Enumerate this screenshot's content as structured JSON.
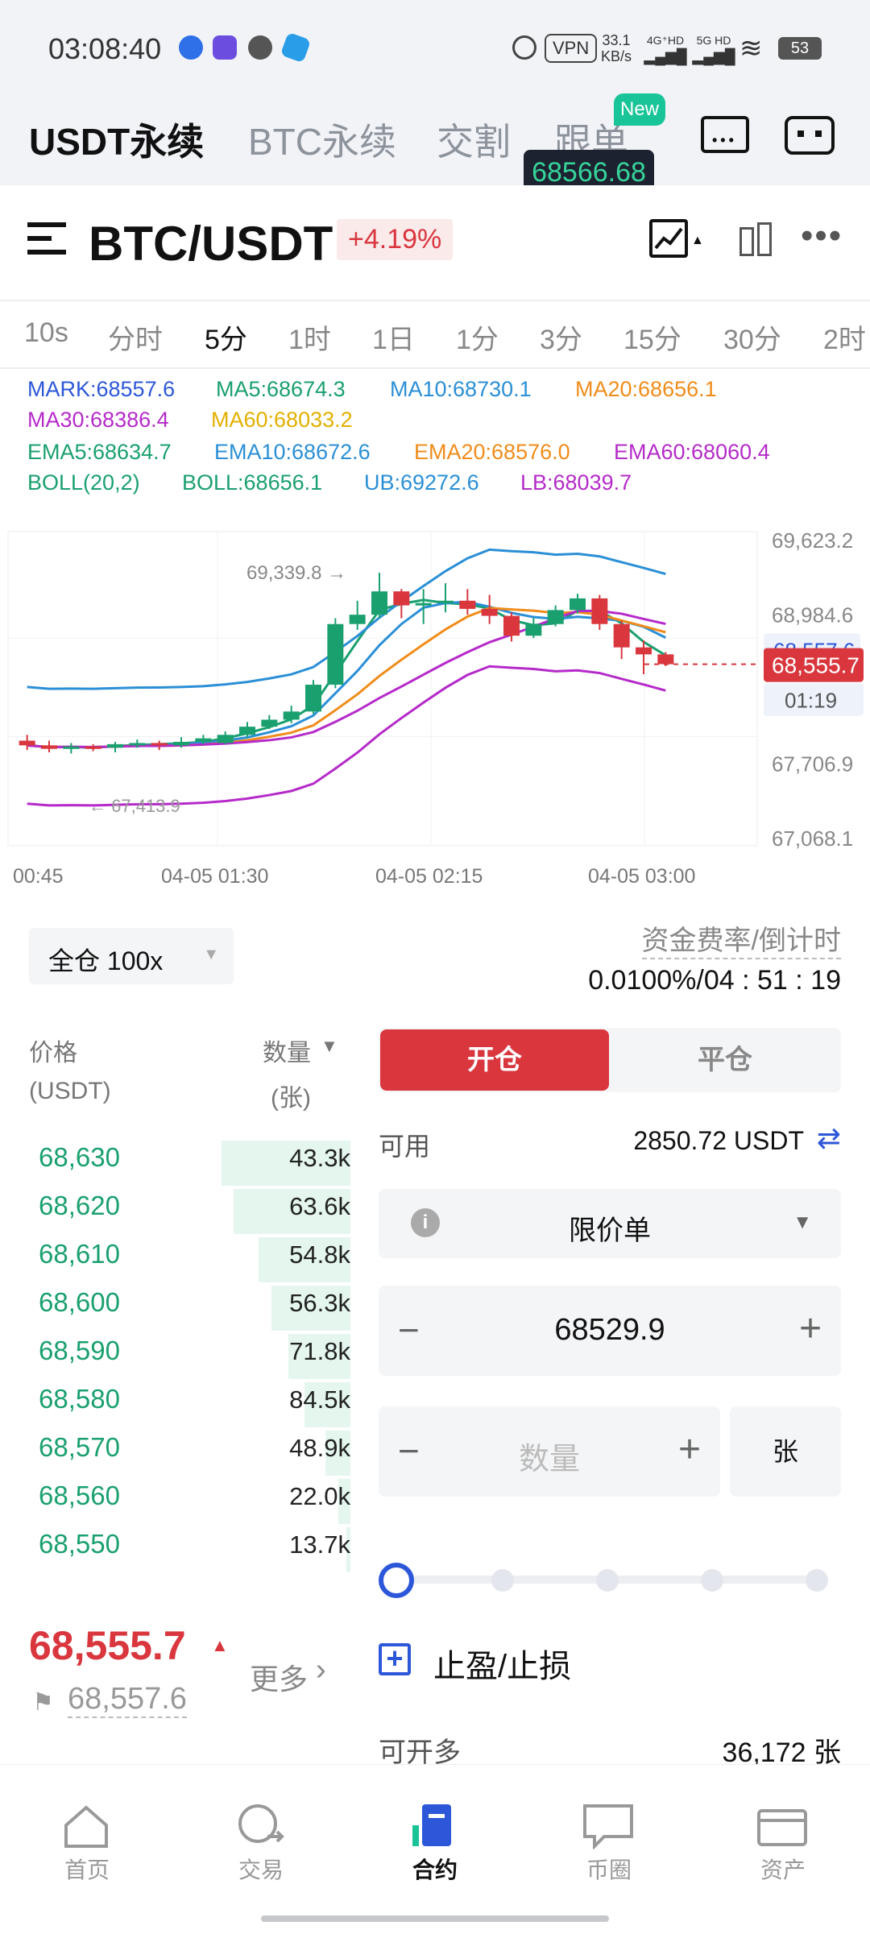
{
  "status_bar": {
    "time": "03:08:40",
    "vpn": "VPN",
    "net_speed": "33.1",
    "net_unit": "KB/s",
    "sig1": "4G⁺HD",
    "sig2": "5G HD",
    "battery": "53"
  },
  "top_tabs": [
    {
      "label": "USDT永续"
    },
    {
      "label": "BTC永续"
    },
    {
      "label": "交割"
    },
    {
      "label": "跟单"
    }
  ],
  "new_badge": "New",
  "floating_price": "68566.68",
  "header": {
    "pair": "BTC/USDT",
    "change": "+4.19%"
  },
  "intervals": [
    {
      "label": "10s"
    },
    {
      "label": "分时"
    },
    {
      "label": "5分"
    },
    {
      "label": "1时"
    },
    {
      "label": "1日"
    },
    {
      "label": "1分"
    },
    {
      "label": "3分"
    },
    {
      "label": "15分"
    },
    {
      "label": "30分"
    },
    {
      "label": "2时"
    }
  ],
  "indicators": {
    "mark": "MARK:68557.6",
    "ma5": "MA5:68674.3",
    "ma10": "MA10:68730.1",
    "ma20": "MA20:68656.1",
    "ma30": "MA30:68386.4",
    "ma60": "MA60:68033.2",
    "ema5": "EMA5:68634.7",
    "ema10": "EMA10:68672.6",
    "ema20": "EMA20:68576.0",
    "ema60": "EMA60:68060.4",
    "boll": "BOLL(20,2)",
    "boll_val": "BOLL:68656.1",
    "ub": "UB:69272.6",
    "lb": "LB:68039.7"
  },
  "chart_data": {
    "type": "candlestick",
    "y_ticks": [
      "69,623.2",
      "68,984.6",
      "67,706.9",
      "67,068.1"
    ],
    "x_ticks": [
      "00:45",
      "04-05 01:30",
      "04-05 02:15",
      "04-05 03:00"
    ],
    "high_label": "69,339.8 →",
    "low_label": "← 67,413.9",
    "mark_label": "68,557.6",
    "last_label": "68,555.7",
    "countdown": "01:19",
    "ylim": [
      67068.1,
      69623.2
    ],
    "candles": [
      {
        "o": 67900,
        "c": 67860,
        "h": 67950,
        "l": 67820
      },
      {
        "o": 67860,
        "c": 67830,
        "h": 67900,
        "l": 67800
      },
      {
        "o": 67830,
        "c": 67850,
        "h": 67880,
        "l": 67790
      },
      {
        "o": 67850,
        "c": 67840,
        "h": 67870,
        "l": 67810
      },
      {
        "o": 67840,
        "c": 67870,
        "h": 67890,
        "l": 67800
      },
      {
        "o": 67870,
        "c": 67880,
        "h": 67910,
        "l": 67840
      },
      {
        "o": 67880,
        "c": 67860,
        "h": 67900,
        "l": 67820
      },
      {
        "o": 67860,
        "c": 67890,
        "h": 67930,
        "l": 67840
      },
      {
        "o": 67890,
        "c": 67920,
        "h": 67950,
        "l": 67870
      },
      {
        "o": 67880,
        "c": 67950,
        "h": 67980,
        "l": 67870
      },
      {
        "o": 67950,
        "c": 68020,
        "h": 68060,
        "l": 67930
      },
      {
        "o": 68020,
        "c": 68080,
        "h": 68120,
        "l": 68000
      },
      {
        "o": 68080,
        "c": 68150,
        "h": 68200,
        "l": 68050
      },
      {
        "o": 68150,
        "c": 68380,
        "h": 68420,
        "l": 68130
      },
      {
        "o": 68380,
        "c": 68900,
        "h": 68950,
        "l": 68350
      },
      {
        "o": 68900,
        "c": 68980,
        "h": 69100,
        "l": 68850
      },
      {
        "o": 68980,
        "c": 69180,
        "h": 69340,
        "l": 68950
      },
      {
        "o": 69180,
        "c": 69060,
        "h": 69200,
        "l": 68950
      },
      {
        "o": 69060,
        "c": 69080,
        "h": 69200,
        "l": 68900
      },
      {
        "o": 69080,
        "c": 69100,
        "h": 69250,
        "l": 69000
      },
      {
        "o": 69100,
        "c": 69030,
        "h": 69200,
        "l": 68980
      },
      {
        "o": 69030,
        "c": 68970,
        "h": 69150,
        "l": 68900
      },
      {
        "o": 68970,
        "c": 68800,
        "h": 69000,
        "l": 68750
      },
      {
        "o": 68800,
        "c": 68900,
        "h": 68950,
        "l": 68780
      },
      {
        "o": 68900,
        "c": 69020,
        "h": 69060,
        "l": 68880
      },
      {
        "o": 69020,
        "c": 69120,
        "h": 69160,
        "l": 68990
      },
      {
        "o": 69120,
        "c": 68900,
        "h": 69150,
        "l": 68850
      },
      {
        "o": 68900,
        "c": 68700,
        "h": 68930,
        "l": 68600
      },
      {
        "o": 68700,
        "c": 68640,
        "h": 68760,
        "l": 68470
      },
      {
        "o": 68640,
        "c": 68556,
        "h": 68660,
        "l": 68540
      }
    ]
  },
  "margin_mode": "全仓 100x",
  "funding": {
    "label": "资金费率/倒计时",
    "value": "0.0100%/04 : 51 : 19"
  },
  "orderbook": {
    "price_header": "价格",
    "price_unit": "(USDT)",
    "qty_header": "数量",
    "qty_unit": "(张)",
    "asks": [
      {
        "price": "68,630",
        "qty": "43.3k",
        "depth": 0.31
      },
      {
        "price": "68,620",
        "qty": "63.6k",
        "depth": 0.28
      },
      {
        "price": "68,610",
        "qty": "54.8k",
        "depth": 0.22
      },
      {
        "price": "68,600",
        "qty": "56.3k",
        "depth": 0.19
      },
      {
        "price": "68,590",
        "qty": "71.8k",
        "depth": 0.15
      },
      {
        "price": "68,580",
        "qty": "84.5k",
        "depth": 0.11
      },
      {
        "price": "68,570",
        "qty": "48.9k",
        "depth": 0.06
      },
      {
        "price": "68,560",
        "qty": "22.0k",
        "depth": 0.03
      },
      {
        "price": "68,550",
        "qty": "13.7k",
        "depth": 0.01
      }
    ],
    "last_price": "68,555.7",
    "mark_price": "68,557.6",
    "more": "更多"
  },
  "order_form": {
    "open_tab": "开仓",
    "close_tab": "平仓",
    "available_label": "可用",
    "available_value": "2850.72 USDT",
    "order_type": "限价单",
    "price": "68529.9",
    "qty_placeholder": "数量",
    "unit": "张",
    "tp_sl": "止盈/止损",
    "can_open_label": "可开多",
    "can_open_value": "36,172 张"
  },
  "bottom_nav": [
    {
      "label": "首页"
    },
    {
      "label": "交易"
    },
    {
      "label": "合约"
    },
    {
      "label": "币圈"
    },
    {
      "label": "资产"
    }
  ],
  "colors": {
    "up": "#1aa06f",
    "down": "#d9363e",
    "accent_blue": "#2c57d8"
  }
}
